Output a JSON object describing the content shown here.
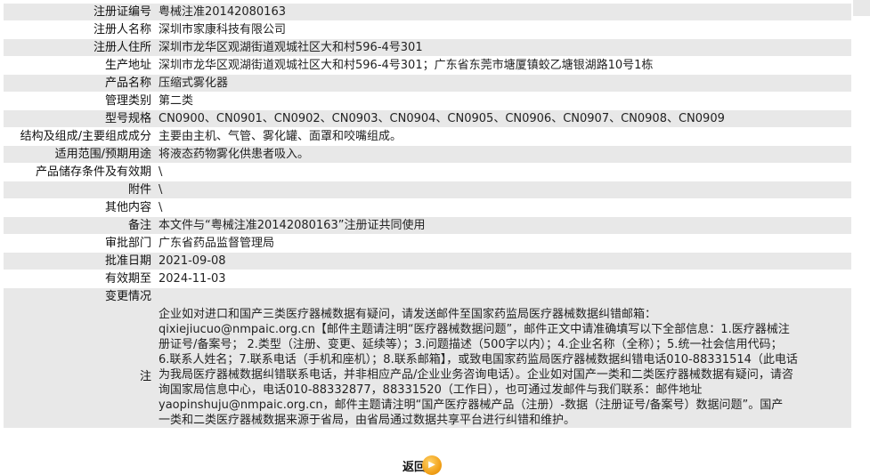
{
  "rows": [
    {
      "label": "注册证编号",
      "value": "粤械注准20142080163"
    },
    {
      "label": "注册人名称",
      "value": "深圳市家康科技有限公司"
    },
    {
      "label": "注册人住所",
      "value": "深圳市龙华区观湖街道观城社区大和村596-4号301"
    },
    {
      "label": "生产地址",
      "value": "深圳市龙华区观湖街道观城社区大和村596-4号301；广东省东莞市塘厦镇蛟乙塘银湖路10号1栋"
    },
    {
      "label": "产品名称",
      "value": "压缩式雾化器"
    },
    {
      "label": "管理类别",
      "value": "第二类"
    },
    {
      "label": "型号规格",
      "value": "CN0900、CN0901、CN0902、CN0903、CN0904、CN0905、CN0906、CN0907、CN0908、CN0909"
    },
    {
      "label": "结构及组成/主要组成成分",
      "value": "主要由主机、气管、雾化罐、面罩和咬嘴组成。"
    },
    {
      "label": "适用范围/预期用途",
      "value": "将液态药物雾化供患者吸入。"
    },
    {
      "label": "产品储存条件及有效期",
      "value": "\\"
    },
    {
      "label": "附件",
      "value": "\\"
    },
    {
      "label": "其他内容",
      "value": "\\"
    },
    {
      "label": "备注",
      "value": "本文件与“粤械注准20142080163”注册证共同使用"
    },
    {
      "label": "审批部门",
      "value": "广东省药品监督管理局"
    },
    {
      "label": "批准日期",
      "value": "2021-09-08"
    },
    {
      "label": "有效期至",
      "value": "2024-11-03"
    }
  ],
  "note": {
    "label_top": "变更情况",
    "label_mid": "注",
    "lines": [
      "企业如对进口和国产三类医疗器械数据有疑问，请发送邮件至国家药监局医疗器械数据纠错邮箱：",
      "qixiejiucuo@nmpaic.org.cn【邮件主题请注明“医疗器械数据问题”，邮件正文中请准确填写以下全部信息：1.医疗器械注",
      "册证号/备案号； 2.类型（注册、变更、延续等）；3.问题描述（500字以内）；4.企业名称（全称）；5.统一社会信用代码；",
      "6.联系人姓名；7.联系电话（手机和座机）；8.联系邮箱】，或致电国家药监局医疗器械数据纠错电话010-88331514（此电话",
      "为我局医疗器械数据纠错联系电话，并非相应产品/企业业务咨询电话）。企业如对国产一类和二类医疗器械数据有疑问，请咨",
      "询国家局信息中心，电话010-88332877，88331520（工作日），也可通过发邮件与我们联系：邮件地址",
      "yaopinshuju@nmpaic.org.cn，邮件主题请注明“国产医疗器械产品（注册）-数据（注册证号/备案号）数据问题”。国产",
      "一类和二类医疗器械数据来源于省局，由省局通过数据共享平台进行纠错和维护。"
    ]
  },
  "back_button": {
    "label": "返回",
    "icon": "arrow-icon"
  }
}
